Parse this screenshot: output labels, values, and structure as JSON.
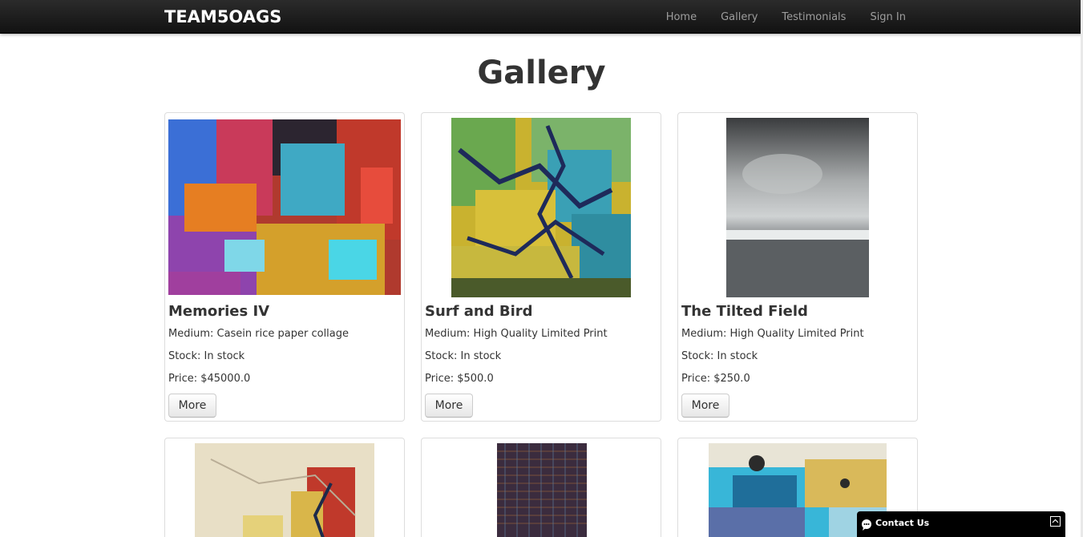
{
  "nav": {
    "brand": "TEAM5OAGS",
    "links": [
      "Home",
      "Gallery",
      "Testimonials",
      "Sign In"
    ]
  },
  "page": {
    "title": "Gallery"
  },
  "gallery": {
    "items": [
      {
        "title": "Memories IV",
        "medium": "Medium: Casein rice paper collage",
        "stock": "Stock: In stock",
        "price": "Price: $45000.0",
        "more_label": "More"
      },
      {
        "title": "Surf and Bird",
        "medium": "Medium: High Quality Limited Print",
        "stock": "Stock: In stock",
        "price": "Price: $500.0",
        "more_label": "More"
      },
      {
        "title": "The Tilted Field",
        "medium": "Medium: High Quality Limited Print",
        "stock": "Stock: In stock",
        "price": "Price: $250.0",
        "more_label": "More"
      }
    ]
  },
  "contact": {
    "label": "Contact Us",
    "icon": "chat-bubble-icon",
    "toggle_icon": "expand-icon"
  },
  "colors": {
    "navbar": "#1b1b1b",
    "nav_link": "#9d9d9d",
    "text": "#333333",
    "card_border": "#dddddd"
  }
}
